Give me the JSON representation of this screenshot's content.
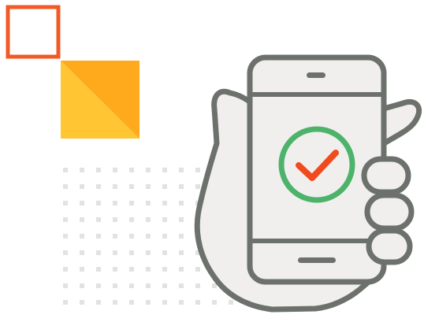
{
  "illustration": {
    "subject": "hand-holding-phone-with-checkmark",
    "icons": [
      "orange-outline-square-icon",
      "yellow-diagonal-square-icon",
      "dot-grid-pattern-icon",
      "hand-icon",
      "smartphone-icon",
      "success-checkmark-icon"
    ]
  },
  "colors": {
    "accent_orange": "#F15A24",
    "yellow_light": "#FFC533",
    "yellow_dark": "#FFA91C",
    "dot_gray": "#E2E2E2",
    "outline_gray": "#6D716C",
    "fill_light": "#F0EFEE",
    "check_green": "#4DB36B",
    "check_mark": "#F04A1E"
  }
}
